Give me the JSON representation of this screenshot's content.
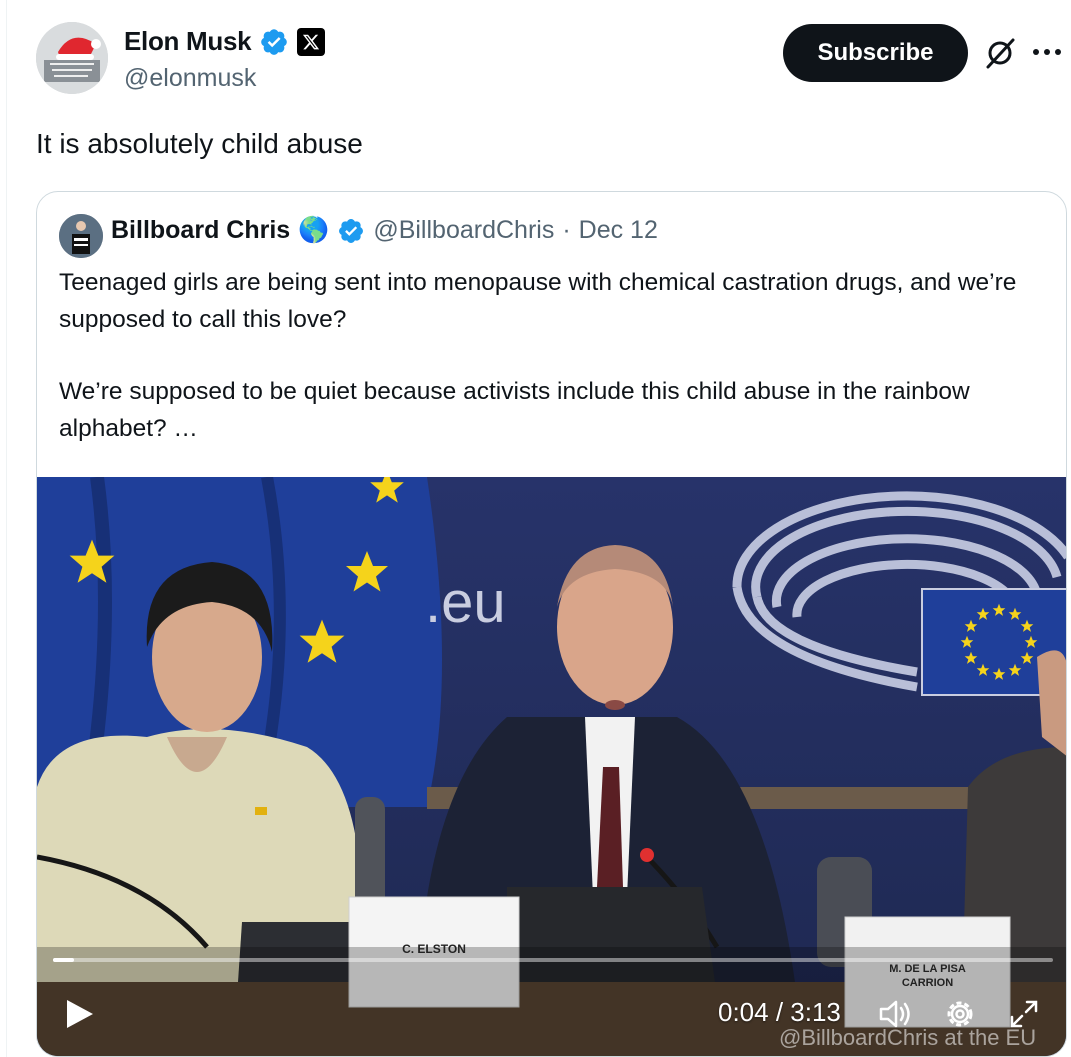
{
  "post": {
    "author_name": "Elon Musk",
    "author_handle": "@elonmusk",
    "subscribe_label": "Subscribe",
    "text": "It is absolutely child abuse"
  },
  "quote": {
    "author_name": "Billboard Chris",
    "author_emoji": "🌎",
    "author_handle": "@BillboardChris",
    "separator": "·",
    "date": "Dec 12",
    "paragraphs": [
      "Teenaged girls are being sent into menopause with chemical castration drugs, and we’re supposed to call this love?",
      "We’re supposed to be quiet because activists include this child abuse in the rainbow alphabet? …"
    ]
  },
  "video": {
    "time_display": "0:04 / 3:13",
    "progress": 0.021,
    "watermark": "@BillboardChris at the EU",
    "backdrop_text": ".eu",
    "placard_center": "C. ELSTON",
    "placard_right_line1": "M. DE LA PISA",
    "placard_right_line2": "CARRION"
  },
  "colors": {
    "brand_blue": "#1d9bf0",
    "text_primary": "#0f1419",
    "text_secondary": "#536471",
    "eu_blue": "#1f3f9a",
    "eu_star": "#f5d31b"
  },
  "icons": [
    "verified-badge-icon",
    "x-logo-icon",
    "grok-icon",
    "more-icon",
    "globe-emoji-icon",
    "play-icon",
    "volume-icon",
    "gear-icon",
    "fullscreen-icon"
  ]
}
